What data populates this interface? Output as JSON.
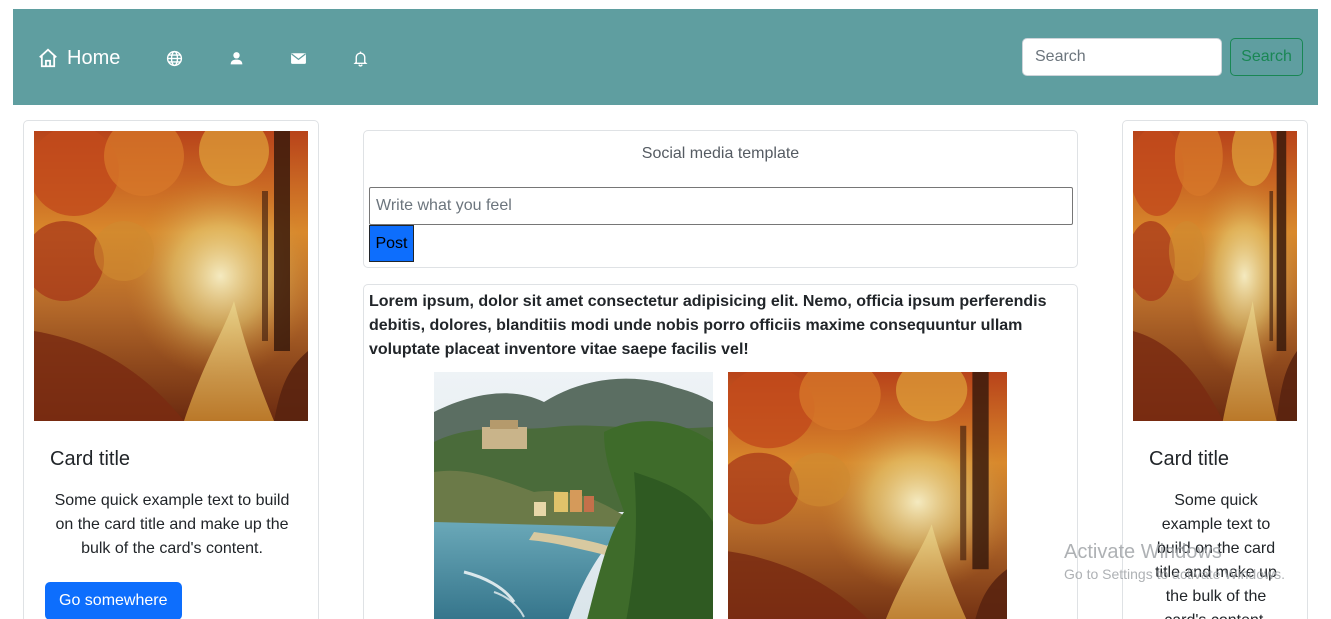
{
  "navbar": {
    "home_label": "Home",
    "icons": [
      "home-icon",
      "globe-icon",
      "person-icon",
      "envelope-icon",
      "bell-icon"
    ],
    "search_placeholder": "Search",
    "search_button": "Search",
    "bg_color": "#5f9ea0"
  },
  "left_card": {
    "image": "autumn-forest-path",
    "title": "Card title",
    "text": "Some quick example text to build on the card title and make up the bulk of the card's content.",
    "button": "Go somewhere"
  },
  "right_card": {
    "image": "autumn-forest-path",
    "title": "Card title",
    "text": "Some quick example text to build on the card title and make up the bulk of the card's content."
  },
  "post_box": {
    "heading": "Social media template",
    "placeholder": "Write what you feel",
    "button": "Post"
  },
  "feed": {
    "text": "Lorem ipsum, dolor sit amet consectetur adipisicing elit. Nemo, officia ipsum perferendis debitis, dolores, blanditiis modi unde nobis porro officiis maxime consequuntur ullam voluptate placeat inventore vitae saepe facilis vel!",
    "images": [
      "coastal-village",
      "autumn-forest-path"
    ]
  },
  "watermark": {
    "title": "Activate Windows",
    "subtitle": "Go to Settings to activate Windows."
  },
  "colors": {
    "primary": "#0d6efd",
    "success": "#198754"
  }
}
